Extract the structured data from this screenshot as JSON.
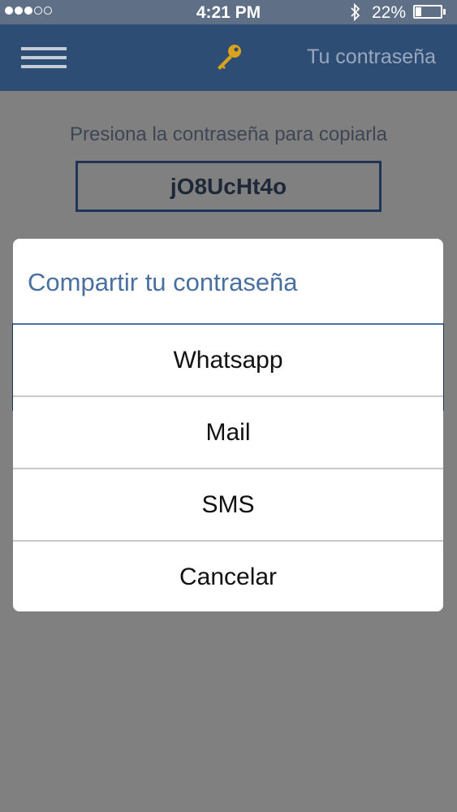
{
  "status_bar": {
    "time": "4:21 PM",
    "battery": "22%",
    "battery_level": 0.22,
    "signal_bars_filled": 3,
    "signal_bars_total": 5,
    "icons": [
      "signal-dots-icon",
      "bluetooth-icon",
      "battery-icon"
    ]
  },
  "nav": {
    "menu_icon": "hamburger-menu-icon",
    "center_icon": "key-icon",
    "title": "Tu contraseña"
  },
  "main": {
    "hint": "Presiona la contraseña para copiarla",
    "password": "jO8UcHt4o"
  },
  "dialog": {
    "title": "Compartir tu contraseña",
    "options": [
      {
        "label": "Whatsapp"
      },
      {
        "label": "Mail"
      },
      {
        "label": "SMS"
      },
      {
        "label": "Cancelar"
      }
    ]
  },
  "colors": {
    "nav_bg": "#2d4d75",
    "dialog_title": "#4a6fa1",
    "overlay": "#808080"
  }
}
